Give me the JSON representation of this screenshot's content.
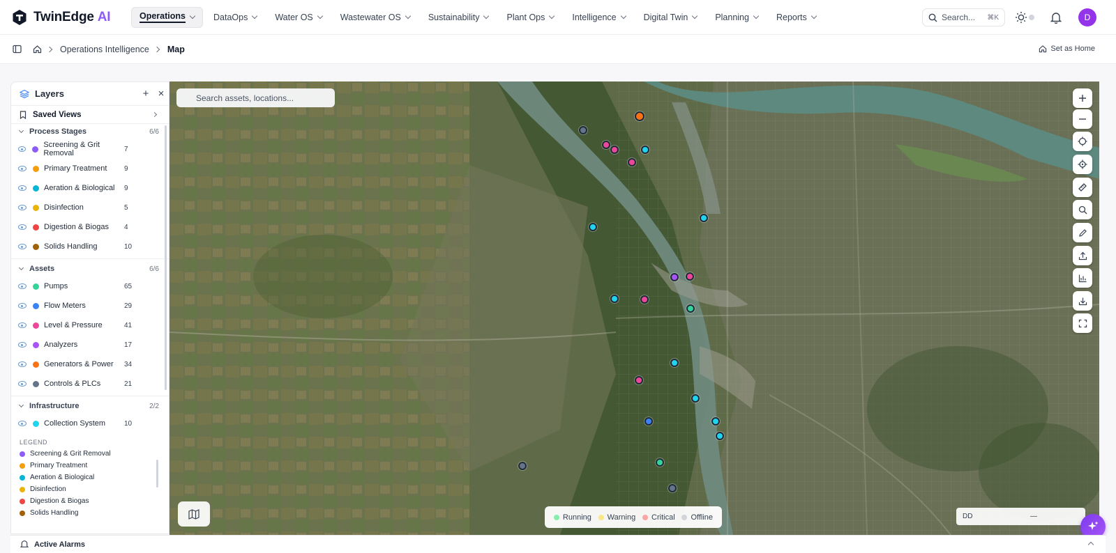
{
  "app": {
    "name": "TwinEdge",
    "name_suffix": "AI"
  },
  "nav": [
    {
      "label": "Operations",
      "active": true
    },
    {
      "label": "DataOps"
    },
    {
      "label": "Water OS"
    },
    {
      "label": "Wastewater OS"
    },
    {
      "label": "Sustainability"
    },
    {
      "label": "Plant Ops"
    },
    {
      "label": "Intelligence"
    },
    {
      "label": "Digital Twin"
    },
    {
      "label": "Planning"
    },
    {
      "label": "Reports"
    }
  ],
  "search": {
    "placeholder": "Search...",
    "shortcut": "⌘K"
  },
  "user": {
    "initial": "D"
  },
  "breadcrumb": {
    "section": "Operations Intelligence",
    "current": "Map",
    "set_home": "Set as Home"
  },
  "layers_panel": {
    "title": "Layers",
    "saved_views": "Saved Views",
    "groups": [
      {
        "name": "Process Stages",
        "count": "6/6",
        "items": [
          {
            "label": "Screening & Grit Removal",
            "count": "7",
            "color": "#8b5cf6"
          },
          {
            "label": "Primary Treatment",
            "count": "9",
            "color": "#f59e0b"
          },
          {
            "label": "Aeration & Biological",
            "count": "9",
            "color": "#06b6d4"
          },
          {
            "label": "Disinfection",
            "count": "5",
            "color": "#eab308"
          },
          {
            "label": "Digestion & Biogas",
            "count": "4",
            "color": "#ef4444"
          },
          {
            "label": "Solids Handling",
            "count": "10",
            "color": "#a16207"
          }
        ]
      },
      {
        "name": "Assets",
        "count": "6/6",
        "items": [
          {
            "label": "Pumps",
            "count": "65",
            "color": "#34d399"
          },
          {
            "label": "Flow Meters",
            "count": "29",
            "color": "#3b82f6"
          },
          {
            "label": "Level & Pressure",
            "count": "41",
            "color": "#ec4899"
          },
          {
            "label": "Analyzers",
            "count": "17",
            "color": "#a855f7"
          },
          {
            "label": "Generators & Power",
            "count": "34",
            "color": "#f97316"
          },
          {
            "label": "Controls & PLCs",
            "count": "21",
            "color": "#64748b"
          }
        ]
      },
      {
        "name": "Infrastructure",
        "count": "2/2",
        "items": [
          {
            "label": "Collection System",
            "count": "10",
            "color": "#22d3ee"
          }
        ]
      }
    ],
    "legend_title": "LEGEND",
    "legend": [
      {
        "label": "Screening & Grit Removal",
        "color": "#8b5cf6"
      },
      {
        "label": "Primary Treatment",
        "color": "#f59e0b"
      },
      {
        "label": "Aeration & Biological",
        "color": "#06b6d4"
      },
      {
        "label": "Disinfection",
        "color": "#eab308"
      },
      {
        "label": "Digestion & Biogas",
        "color": "#ef4444"
      },
      {
        "label": "Solids Handling",
        "color": "#a16207"
      }
    ]
  },
  "map": {
    "search_placeholder": "Search assets, locations...",
    "status_legend": [
      {
        "label": "Running",
        "color": "#86efac"
      },
      {
        "label": "Warning",
        "color": "#fde68a"
      },
      {
        "label": "Critical",
        "color": "#fca5a5"
      },
      {
        "label": "Offline",
        "color": "#d1d5db"
      }
    ],
    "coord_format": "DD",
    "coord_value": "—",
    "controls": [
      "zoom-in-icon",
      "zoom-out-icon",
      "locate-icon",
      "crosshair-icon",
      "measure-icon",
      "search-icon",
      "draw-icon",
      "upload-icon",
      "chart-icon",
      "download-icon",
      "fullscreen-icon"
    ]
  },
  "footer": {
    "alarms_label": "Active Alarms"
  }
}
